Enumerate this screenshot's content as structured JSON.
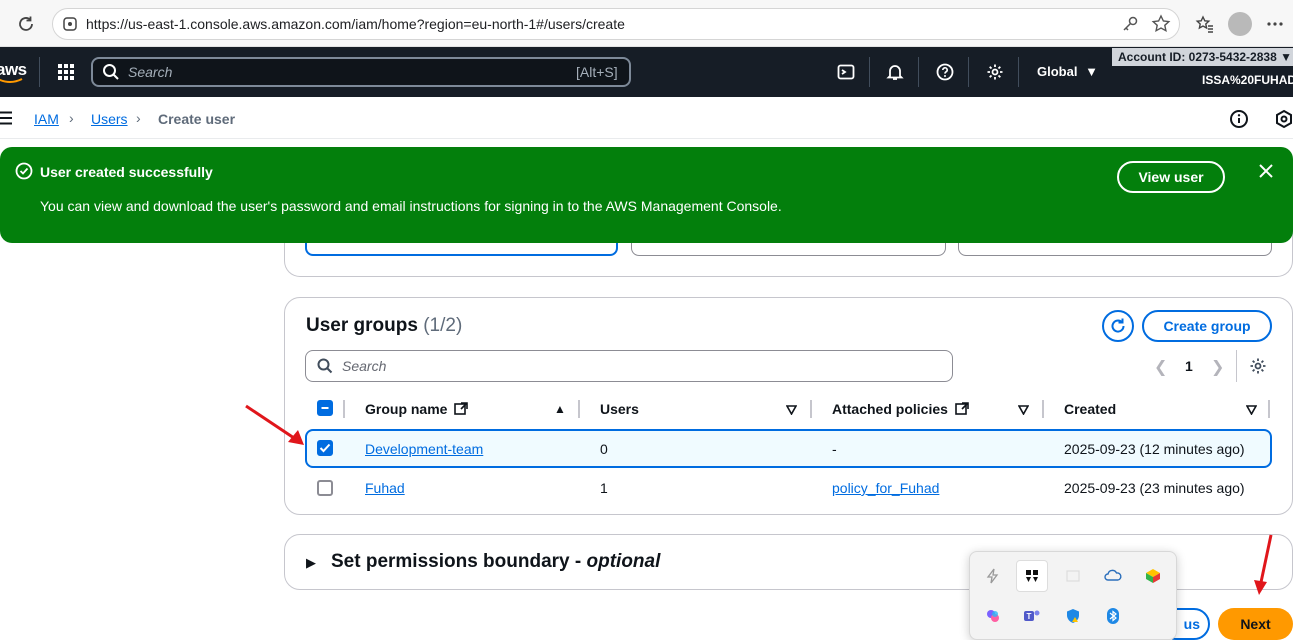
{
  "browser": {
    "url": "https://us-east-1.console.aws.amazon.com/iam/home?region=eu-north-1#/users/create"
  },
  "aws_nav": {
    "logo": "aws",
    "search_placeholder": "Search",
    "search_shortcut": "[Alt+S]",
    "region": "Global",
    "account_id": "Account ID: 0273-5432-2838",
    "user_name": "ISSA%20FUHAD"
  },
  "breadcrumb": {
    "items": [
      "IAM",
      "Users"
    ],
    "current": "Create user"
  },
  "flash": {
    "title": "User created successfully",
    "message": "You can view and download the user's password and email instructions for signing in to the AWS Management Console.",
    "action_label": "View user"
  },
  "user_groups": {
    "title": "User groups",
    "count": "(1/2)",
    "create_label": "Create group",
    "search_placeholder": "Search",
    "page": "1",
    "columns": [
      "Group name",
      "Users",
      "Attached policies",
      "Created"
    ],
    "rows": [
      {
        "name": "Development-team",
        "users": "0",
        "policies": "-",
        "created": "2025-09-23 (12 minutes ago)",
        "selected": true
      },
      {
        "name": "Fuhad",
        "users": "1",
        "policies": "policy_for_Fuhad",
        "created": "2025-09-23 (23 minutes ago)",
        "selected": false
      }
    ]
  },
  "boundary": {
    "title": "Set permissions boundary - ",
    "optional": "optional"
  },
  "footer": {
    "previous_label": "us",
    "next_label": "Next"
  },
  "colors": {
    "aws_nav": "#161d26",
    "success": "#037f0c",
    "link": "#006ce0",
    "primary_button": "#ff9900",
    "annotation_arrow": "#e0161b"
  }
}
